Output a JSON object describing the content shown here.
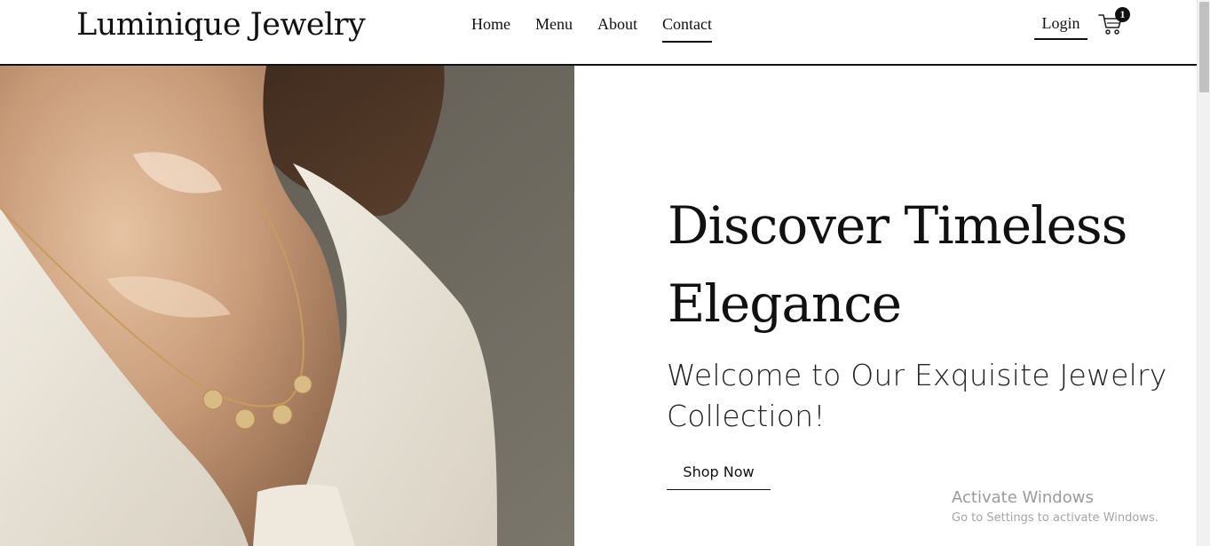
{
  "header": {
    "logo": "Luminique Jewelry",
    "nav": [
      {
        "label": "Home"
      },
      {
        "label": "Menu"
      },
      {
        "label": "About"
      },
      {
        "label": "Contact",
        "active": true
      }
    ],
    "login_label": "Login",
    "cart_count": "1"
  },
  "hero": {
    "image_alt": "Woman wearing a gold coin necklace with a white shirt",
    "title": "Discover Timeless Elegance",
    "subtitle": "Welcome to Our Exquisite Jewelry Collection!",
    "button_label": "Shop Now"
  },
  "watermark": {
    "title": "Activate Windows",
    "subtitle": "Go to Settings to activate Windows."
  },
  "colors": {
    "text": "#111111",
    "background": "#ffffff",
    "scrollbar_thumb": "#c1c1c1"
  },
  "icons": [
    "shopping-cart-icon"
  ]
}
